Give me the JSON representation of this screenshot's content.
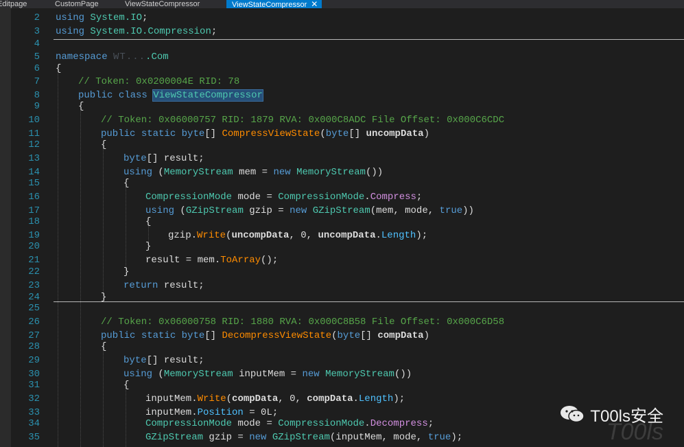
{
  "tabs": [
    {
      "label": "Editpage",
      "active": false
    },
    {
      "label": "CustomPage",
      "active": false
    },
    {
      "label": "ViewStateCompressor",
      "active": false
    },
    {
      "label": "ViewStateCompressor",
      "active": true,
      "close": "✕"
    }
  ],
  "line_numbers": [
    "2",
    "3",
    "4",
    "5",
    "6",
    "7",
    "8",
    "9",
    "10",
    "11",
    "12",
    "13",
    "14",
    "15",
    "16",
    "17",
    "18",
    "19",
    "20",
    "21",
    "22",
    "23",
    "24",
    "25",
    "26",
    "27",
    "28",
    "29",
    "30",
    "31",
    "32",
    "33",
    "34",
    "35"
  ],
  "code": {
    "l2": {
      "kw": "using",
      "ns": "System.IO",
      "end": ";"
    },
    "l3": {
      "kw": "using",
      "ns": "System.IO.Compression",
      "end": ";"
    },
    "l5": {
      "kw": "namespace",
      "blur": "WT...",
      "suffix": ".Com"
    },
    "l6": "{",
    "l7": "// Token: 0x0200004E RID: 78",
    "l8": {
      "kw1": "public",
      "kw2": "class",
      "name": "ViewStateCompressor"
    },
    "l9": "{",
    "l10": "// Token: 0x06000757 RID: 1879 RVA: 0x000C8ADC File Offset: 0x000C6CDC",
    "l11": {
      "kw1": "public",
      "kw2": "static",
      "ty": "byte",
      "br": "[]",
      "method": "CompressViewState",
      "p1": "(",
      "pty": "byte",
      "pbr": "[]",
      "param": "uncompData",
      "p2": ")"
    },
    "l12": "{",
    "l13": {
      "ty": "byte",
      "rest": "[] result;"
    },
    "l14": {
      "kw": "using",
      "a": "(",
      "t1": "MemoryStream",
      "b": "mem =",
      "kw2": "new",
      "t2": "MemoryStream",
      "c": "())"
    },
    "l15": "{",
    "l16": {
      "t1": "CompressionMode",
      "a": "mode =",
      "t2": "CompressionMode",
      "dot": ".",
      "en": "Compress",
      "end": ";"
    },
    "l17": {
      "kw": "using",
      "a": "(",
      "t1": "GZipStream",
      "b": "gzip =",
      "kw2": "new",
      "t2": "GZipStream",
      "c": "(mem, mode,",
      "kw3": "true",
      "d": "))"
    },
    "l18": "{",
    "l19": {
      "a": "gzip.",
      "m": "Write",
      "b": "(",
      "p1": "uncompData",
      "c": ", 0,",
      "p2": "uncompData",
      "d": ".",
      "pr": "Length",
      "e": ");"
    },
    "l20": "}",
    "l21": {
      "a": "result = mem.",
      "m": "ToArray",
      "b": "();"
    },
    "l22": "}",
    "l23": {
      "kw": "return",
      "rest": "result;"
    },
    "l24": "}",
    "l26": "// Token: 0x06000758 RID: 1880 RVA: 0x000C8B58 File Offset: 0x000C6D58",
    "l27": {
      "kw1": "public",
      "kw2": "static",
      "ty": "byte",
      "br": "[]",
      "method": "DecompressViewState",
      "p1": "(",
      "pty": "byte",
      "pbr": "[]",
      "param": "compData",
      "p2": ")"
    },
    "l28": "{",
    "l29": {
      "ty": "byte",
      "rest": "[] result;"
    },
    "l30": {
      "kw": "using",
      "a": "(",
      "t1": "MemoryStream",
      "b": "inputMem =",
      "kw2": "new",
      "t2": "MemoryStream",
      "c": "())"
    },
    "l31": "{",
    "l32": {
      "a": "inputMem.",
      "m": "Write",
      "b": "(",
      "p1": "compData",
      "c": ", 0,",
      "p2": "compData",
      "d": ".",
      "pr": "Length",
      "e": ");"
    },
    "l33": {
      "a": "inputMem.",
      "pr": "Position",
      "b": "= 0L;"
    },
    "l34": {
      "t1": "CompressionMode",
      "a": "mode =",
      "t2": "CompressionMode",
      "dot": ".",
      "en": "Decompress",
      "end": ";"
    },
    "l35": {
      "t1": "GZipStream",
      "a": "gzip =",
      "kw": "new",
      "t2": "GZipStream",
      "b": "(inputMem, mode,",
      "kw2": "true",
      "c": ");"
    }
  },
  "watermark": {
    "text": "T00ls安全",
    "bg": "T00ls"
  },
  "colors": {
    "background": "#1e1e1e",
    "keyword": "#569cd6",
    "type": "#4ec9b0",
    "comment": "#57a64a",
    "method": "#ff8c00",
    "line_number": "#2b91af",
    "tab_active": "#007acc"
  }
}
